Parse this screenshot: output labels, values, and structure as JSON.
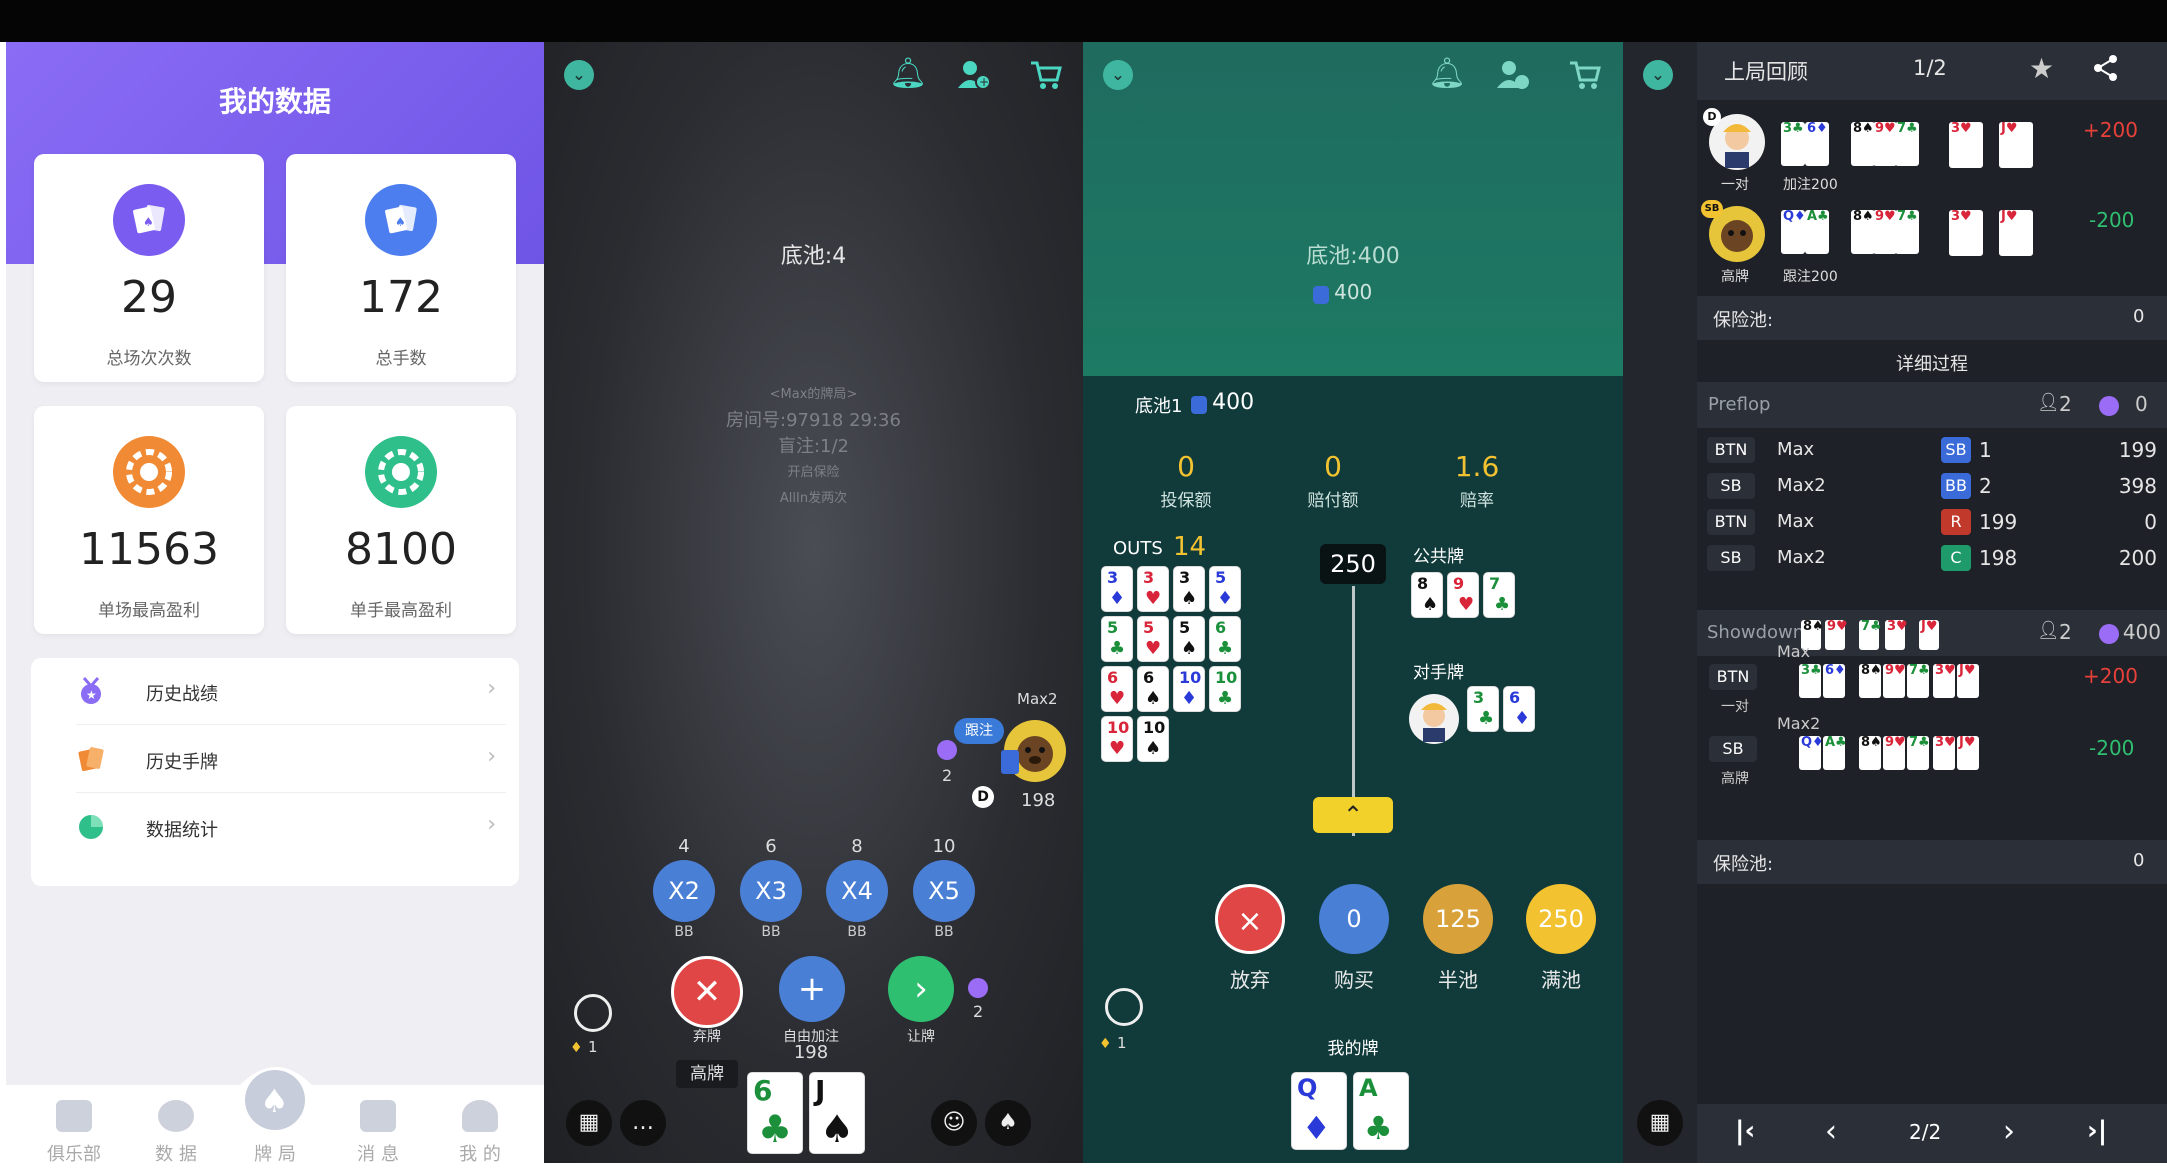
{
  "colors": {
    "accent_purple": "#7b61f0",
    "teal": "#4ad6c0",
    "win": "#e8413a",
    "lose": "#2fbf71"
  },
  "p1": {
    "title": "我的数据",
    "stats": [
      {
        "value": "29",
        "label": "总场次次数",
        "icon": "cards-icon"
      },
      {
        "value": "172",
        "label": "总手数",
        "icon": "cards-icon"
      },
      {
        "value": "11563",
        "label": "单场最高盈利",
        "icon": "chip-icon"
      },
      {
        "value": "8100",
        "label": "单手最高盈利",
        "icon": "chip-icon"
      }
    ],
    "menu": [
      {
        "label": "历史战绩",
        "arrow": "›"
      },
      {
        "label": "历史手牌",
        "arrow": "›"
      },
      {
        "label": "数据统计",
        "arrow": "›"
      }
    ],
    "tabs": [
      "俱乐部",
      "数 据",
      "牌 局",
      "消 息",
      "我 的"
    ]
  },
  "p2": {
    "pot": "底池:4",
    "info": [
      "<Max的牌局>",
      "房间号:97918  29:36",
      "盲注:1/2",
      "开启保险",
      "AllIn发两次"
    ],
    "opponent": {
      "name": "Max2",
      "stack": "198",
      "action": "跟注",
      "bet": "2",
      "dealer": "D"
    },
    "raise_opts": [
      {
        "top": "4",
        "label": "X2",
        "unit": "BB"
      },
      {
        "top": "6",
        "label": "X3",
        "unit": "BB"
      },
      {
        "top": "8",
        "label": "X4",
        "unit": "BB"
      },
      {
        "top": "10",
        "label": "X5",
        "unit": "BB"
      }
    ],
    "actions": {
      "fold": "弃牌",
      "raise": "自由加注",
      "check": "让牌",
      "stack": "198",
      "my_bet": "2"
    },
    "hand_rank": "高牌",
    "timer_count": "1",
    "hand": [
      {
        "rank": "6",
        "suit": "♣"
      },
      {
        "rank": "J",
        "suit": "♠"
      }
    ]
  },
  "p3": {
    "pot_title": "底池:400",
    "pot_chips": "400",
    "pot1_label": "底池1",
    "pot1_value": "400",
    "ins": [
      {
        "value": "0",
        "label": "投保额"
      },
      {
        "value": "0",
        "label": "赔付额"
      },
      {
        "value": "1.6",
        "label": "赔率"
      }
    ],
    "outs_label": "OUTS",
    "outs_value": "14",
    "slider_value": "250",
    "community_label": "公共牌",
    "opp_label": "对手牌",
    "my_label": "我的牌",
    "buttons": [
      {
        "value": "×",
        "label": "放弃"
      },
      {
        "value": "0",
        "label": "购买"
      },
      {
        "value": "125",
        "label": "半池"
      },
      {
        "value": "250",
        "label": "满池"
      }
    ],
    "timer_count": "1",
    "outs_cards": [
      {
        "r": "3",
        "s": "♦"
      },
      {
        "r": "3",
        "s": "♥"
      },
      {
        "r": "3",
        "s": "♠"
      },
      {
        "r": "5",
        "s": "♦"
      },
      {
        "r": "5",
        "s": "♣"
      },
      {
        "r": "5",
        "s": "♥"
      },
      {
        "r": "5",
        "s": "♠"
      },
      {
        "r": "6",
        "s": "♣"
      },
      {
        "r": "6",
        "s": "♥"
      },
      {
        "r": "6",
        "s": "♠"
      },
      {
        "r": "10",
        "s": "♦"
      },
      {
        "r": "10",
        "s": "♣"
      },
      {
        "r": "10",
        "s": "♥"
      },
      {
        "r": "10",
        "s": "♠"
      }
    ],
    "community": [
      {
        "r": "8",
        "s": "♠"
      },
      {
        "r": "9",
        "s": "♥"
      },
      {
        "r": "7",
        "s": "♣"
      }
    ],
    "opp_cards": [
      {
        "r": "3",
        "s": "♣"
      },
      {
        "r": "6",
        "s": "♦"
      }
    ],
    "my_cards": [
      {
        "r": "Q",
        "s": "♦"
      },
      {
        "r": "A",
        "s": "♣"
      }
    ]
  },
  "p4": {
    "title": "上局回顾",
    "page": "1/2",
    "players": [
      {
        "badge": "D",
        "rank": "一对",
        "action": "加注200",
        "result": "+200"
      },
      {
        "badge": "SB",
        "rank": "高牌",
        "action": "跟注200",
        "result": "-200"
      }
    ],
    "insurance_label": "保险池:",
    "insurance_value": "0",
    "detail_title": "详细过程",
    "preflop_label": "Preflop",
    "preflop_count": "2",
    "preflop_value": "0",
    "preflop_rows": [
      {
        "pos": "BTN",
        "name": "Max",
        "tag": "SB",
        "tag_val": "1",
        "total": "199"
      },
      {
        "pos": "SB",
        "name": "Max2",
        "tag": "BB",
        "tag_val": "2",
        "total": "398"
      },
      {
        "pos": "BTN",
        "name": "Max",
        "tag": "R",
        "tag_val": "199",
        "total": "0"
      },
      {
        "pos": "SB",
        "name": "Max2",
        "tag": "C",
        "tag_val": "198",
        "total": "200"
      }
    ],
    "showdown_label": "Showdown",
    "showdown_count": "2",
    "showdown_value": "400",
    "sd_players": [
      {
        "name": "Max",
        "pos": "BTN",
        "rank": "一对",
        "result": "+200"
      },
      {
        "name": "Max2",
        "pos": "SB",
        "rank": "高牌",
        "result": "-200"
      }
    ],
    "insurance2_label": "保险池:",
    "insurance2_value": "0",
    "nav": [
      "|‹",
      "‹",
      "2/2",
      "›",
      "›|"
    ]
  }
}
